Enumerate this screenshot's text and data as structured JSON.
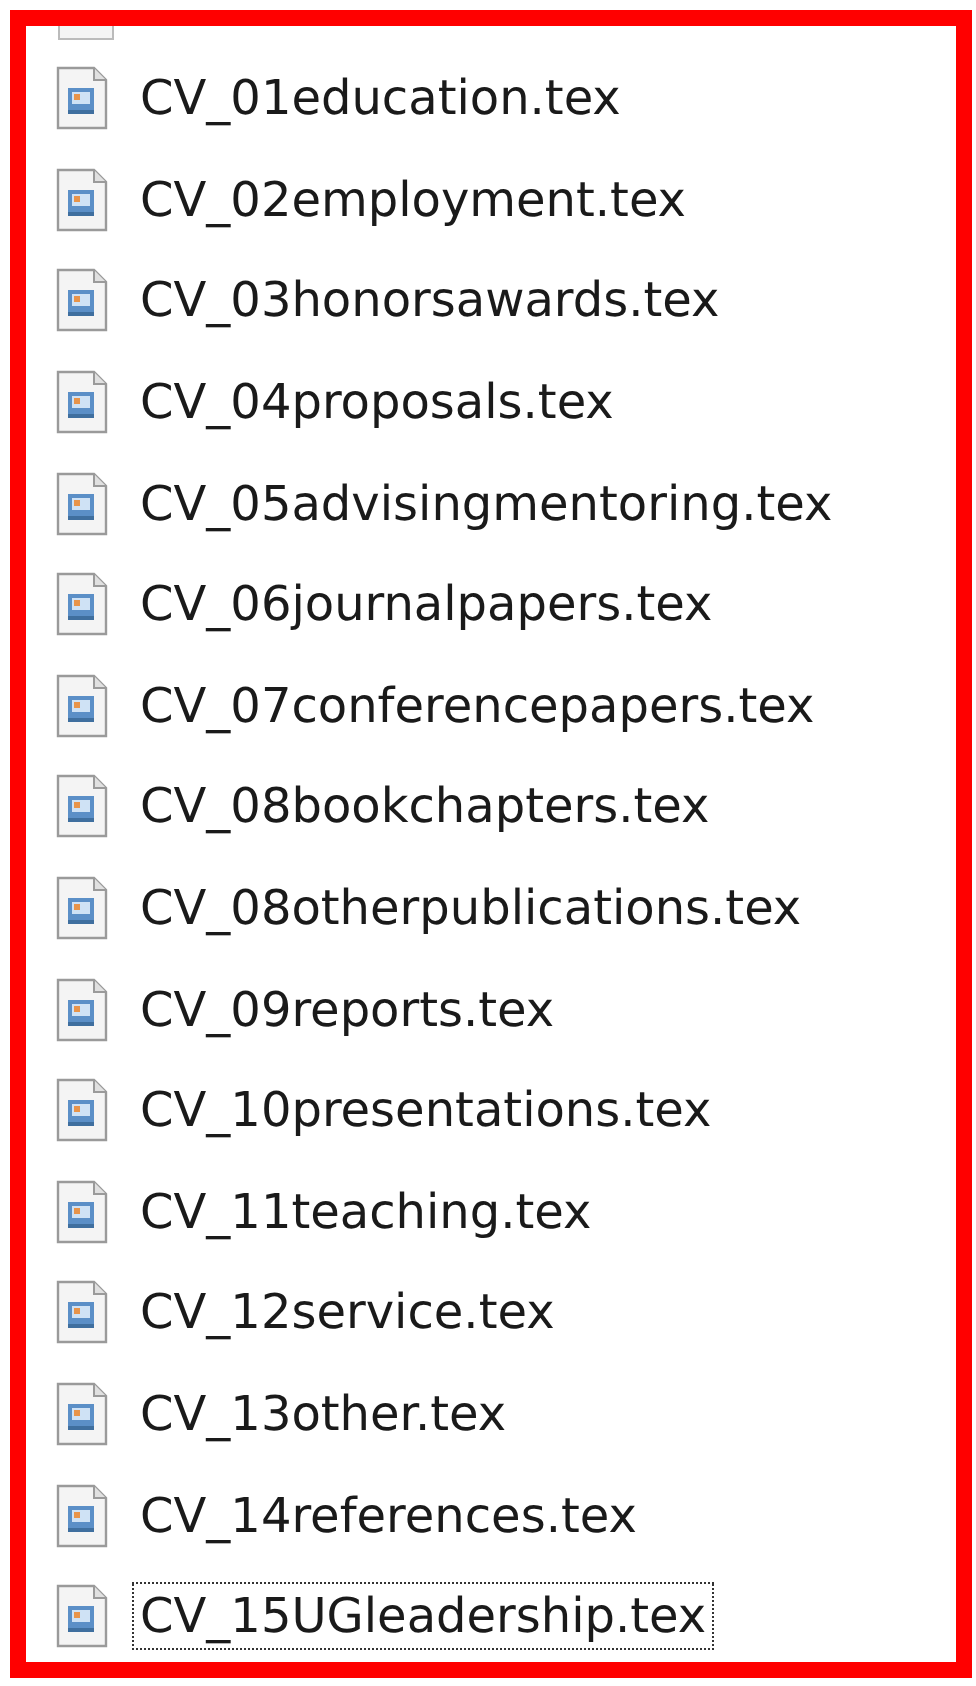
{
  "files": [
    {
      "name": "CV_01education.tex",
      "focused": false
    },
    {
      "name": "CV_02employment.tex",
      "focused": false
    },
    {
      "name": "CV_03honorsawards.tex",
      "focused": false
    },
    {
      "name": "CV_04proposals.tex",
      "focused": false
    },
    {
      "name": "CV_05advisingmentoring.tex",
      "focused": false
    },
    {
      "name": "CV_06journalpapers.tex",
      "focused": false
    },
    {
      "name": "CV_07conferencepapers.tex",
      "focused": false
    },
    {
      "name": "CV_08bookchapters.tex",
      "focused": false
    },
    {
      "name": "CV_08otherpublications.tex",
      "focused": false
    },
    {
      "name": "CV_09reports.tex",
      "focused": false
    },
    {
      "name": "CV_10presentations.tex",
      "focused": false
    },
    {
      "name": "CV_11teaching.tex",
      "focused": false
    },
    {
      "name": "CV_12service.tex",
      "focused": false
    },
    {
      "name": "CV_13other.tex",
      "focused": false
    },
    {
      "name": "CV_14references.tex",
      "focused": false
    },
    {
      "name": "CV_15UGleadership.tex",
      "focused": true
    }
  ]
}
